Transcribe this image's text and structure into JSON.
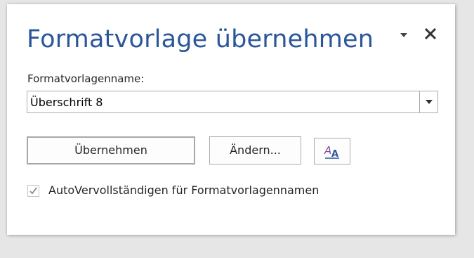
{
  "pane": {
    "title": "Formatvorlage übernehmen",
    "options_icon": "dropdown-triangle-icon",
    "close_icon": "close-x-icon"
  },
  "style_name": {
    "label": "Formatvorlagenname:",
    "value": "Überschrift 8",
    "dropdown_icon": "chevron-down-icon"
  },
  "buttons": {
    "apply_label": "Übernehmen",
    "modify_label": "Ändern...",
    "styles_icon": "styles-pane-icon"
  },
  "autocomplete": {
    "label": "AutoVervollständigen für Formatvorlagennamen",
    "checked": true
  },
  "colors": {
    "title": "#2b579a",
    "background": "#e6e6e6",
    "pane": "#ffffff",
    "border": "#ababab"
  }
}
